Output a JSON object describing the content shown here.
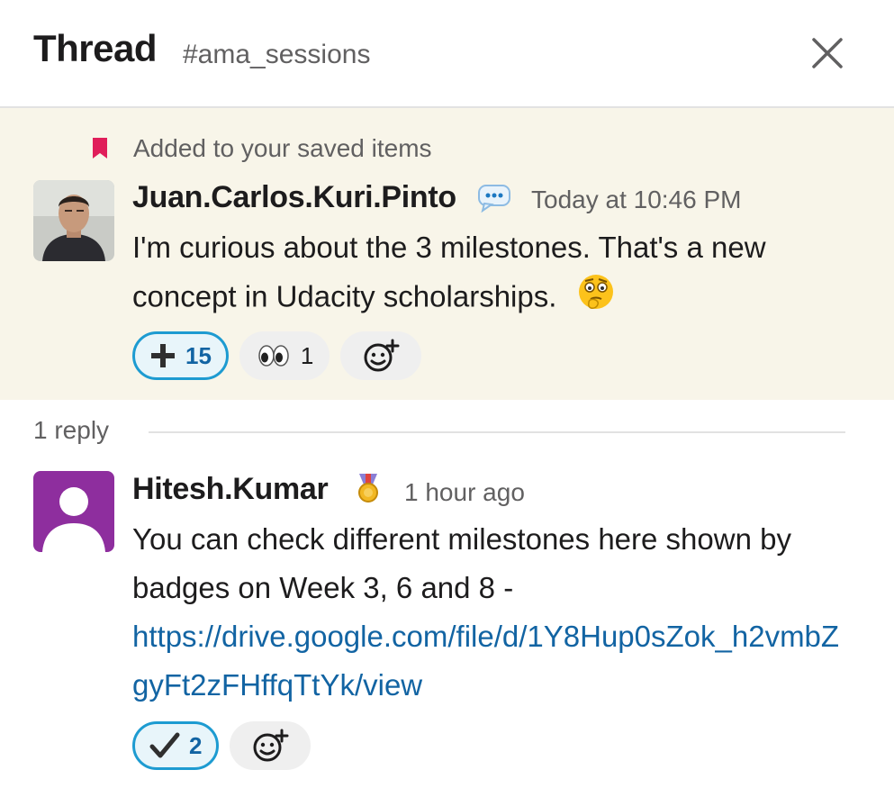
{
  "header": {
    "title": "Thread",
    "channel": "#ama_sessions",
    "close_icon": "close-icon"
  },
  "parent_message": {
    "saved_notice": "Added to your saved items",
    "author": "Juan.Carlos.Kuri.Pinto",
    "status_emoji": "speech-bubble-icon",
    "timestamp": "Today at 10:46 PM",
    "text": "I'm curious about the 3 milestones. That's a new concept in Udacity scholarships.",
    "inline_emoji": "thinking-face-icon",
    "reactions": [
      {
        "emoji": "heavy-plus-icon",
        "count": "15",
        "active": true
      },
      {
        "emoji": "eyes-icon",
        "count": "1",
        "active": false
      }
    ],
    "add_reaction_icon": "add-reaction-icon"
  },
  "replies_divider": {
    "label": "1 reply"
  },
  "reply": {
    "author": "Hitesh.Kumar",
    "status_emoji": "medal-icon",
    "timestamp": "1 hour ago",
    "text": "You can check different milestones here shown by badges on Week 3, 6 and 8 -",
    "link": "https://drive.google.com/file/d/1Y8Hup0sZok_h2vmbZgyFt2zFHffqTtYk/view",
    "reactions": [
      {
        "emoji": "check-mark-icon",
        "count": "2",
        "active": true
      }
    ],
    "add_reaction_icon": "add-reaction-icon"
  },
  "colors": {
    "saved_background": "#f8f5e9",
    "link": "#1264a3",
    "reaction_active_border": "#1d9bd1",
    "bookmark": "#e01e5a",
    "reply_avatar": "#8e2e9e"
  }
}
